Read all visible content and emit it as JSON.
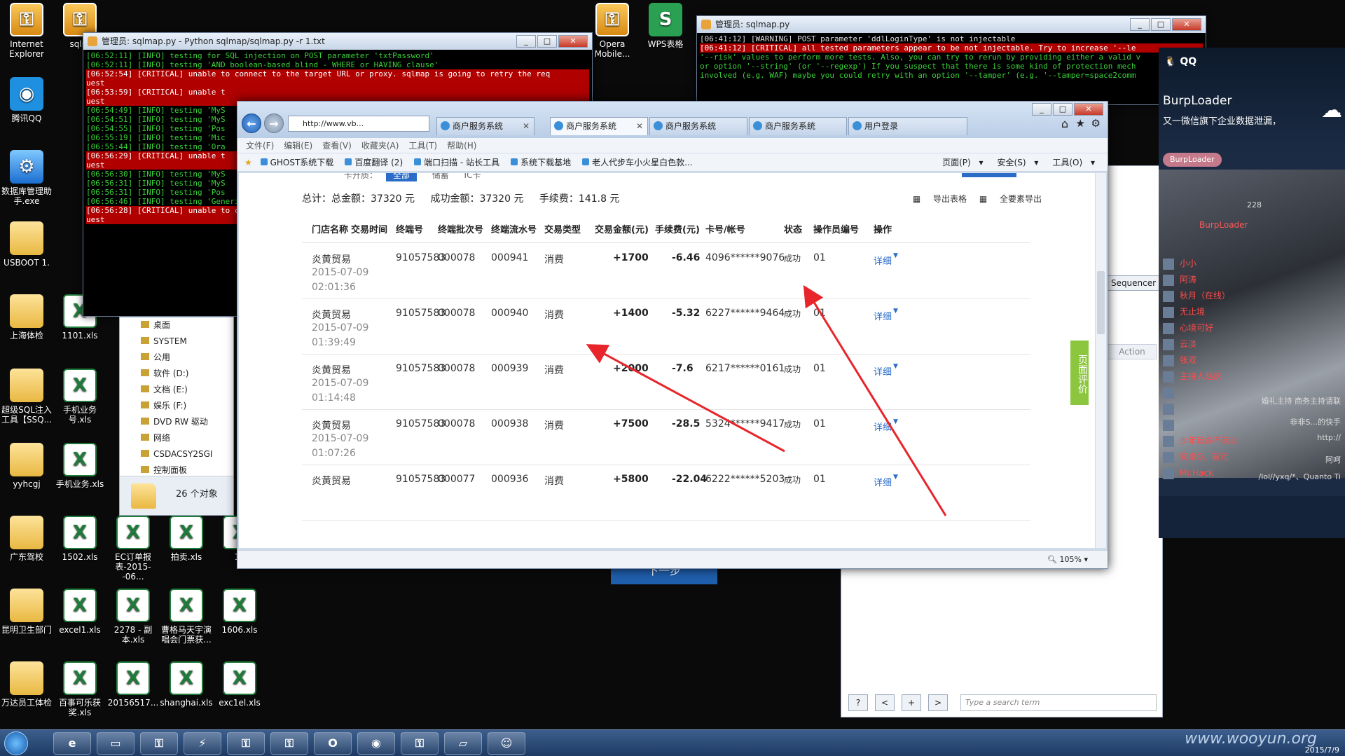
{
  "desktop": {
    "icons": [
      {
        "label": "Internet Explorer",
        "glyph": "key-icon"
      },
      {
        "label": "sqlm",
        "glyph": "key-icon"
      },
      {
        "label": "腾讯QQ",
        "glyph": "qq-icon"
      },
      {
        "label": "数据库管理助手.exe",
        "glyph": "app-icon"
      },
      {
        "label": "USBOOT 1.",
        "glyph": "folder-icon"
      },
      {
        "label": "上海体检",
        "glyph": "folder-icon"
      },
      {
        "label": "1101.xls",
        "glyph": "xls-icon"
      },
      {
        "label": "超级SQL注入工具【SSQ...",
        "glyph": "folder-icon"
      },
      {
        "label": "手机业务号.xls",
        "glyph": "xls-icon"
      },
      {
        "label": "yyhcgj",
        "glyph": "folder-icon"
      },
      {
        "label": "手机业务.xls",
        "glyph": "xls-icon"
      },
      {
        "label": "广东驾校",
        "glyph": "folder-icon"
      },
      {
        "label": "1502.xls",
        "glyph": "xls-icon"
      },
      {
        "label": "EC订单报表-2015--06...",
        "glyph": "xls-icon"
      },
      {
        "label": "拍卖.xls",
        "glyph": "xls-icon"
      },
      {
        "label": "13",
        "glyph": "xls-icon"
      },
      {
        "label": "昆明卫生部门",
        "glyph": "folder-icon"
      },
      {
        "label": "excel1.xls",
        "glyph": "xls-icon"
      },
      {
        "label": "2278 - 副本.xls",
        "glyph": "xls-icon"
      },
      {
        "label": "曹格马天宇演唱会门票获...",
        "glyph": "xls-icon"
      },
      {
        "label": "1606.xls",
        "glyph": "xls-icon"
      },
      {
        "label": "万达员工体检",
        "glyph": "folder-icon"
      },
      {
        "label": "百事可乐获奖.xls",
        "glyph": "xls-icon"
      },
      {
        "label": "20156517...",
        "glyph": "xls-icon"
      },
      {
        "label": "shanghai.xls",
        "glyph": "xls-icon"
      },
      {
        "label": "exc1el.xls",
        "glyph": "xls-icon"
      },
      {
        "label": "Opera Mobile...",
        "glyph": "key-icon"
      },
      {
        "label": "WPS表格",
        "glyph": "wps-icon"
      }
    ]
  },
  "console1": {
    "title": "管理员: sqlmap.py - Python  sqlmap/sqlmap.py -r 1.txt",
    "lines": [
      "[06:52:11] [INFO] testing for SQL injection on POST parameter 'txtPassword'",
      "[06:52:11] [INFO] testing 'AND boolean-based blind - WHERE or HAVING clause'",
      "[06:52:54] [CRITICAL] unable to connect to the target URL or proxy. sqlmap is going to retry the req",
      "uest",
      "[06:53:59] [CRITICAL] unable t",
      "uest",
      "[06:54:49] [INFO] testing 'MyS",
      "[06:54:51] [INFO] testing 'MyS",
      "[06:54:55] [INFO] testing 'Pos",
      "[06:55:19] [INFO] testing 'Mic",
      "[06:55:44] [INFO] testing 'Ora",
      "[06:56:29] [CRITICAL] unable t",
      "uest",
      "[06:56:30] [INFO] testing 'MyS",
      "[06:56:31] [INFO] testing 'MyS",
      "[06:56:31] [INFO] testing 'Pos",
      "[06:56:46] [INFO] testing 'Generic UN",
      "[06:56:28] [CRITICAL] unable to conne",
      "uest"
    ]
  },
  "console2": {
    "title": "管理员: sqlmap.py",
    "lines": [
      "[06:41:12] [WARNING] POST parameter 'ddlLoginType' is not injectable",
      "[06:41:12] [CRITICAL] all tested parameters appear to be not injectable. Try to increase '--le",
      "'--risk' values to perform more tests. Also, you can try to rerun by providing either a valid v",
      "or option '--string' (or '--regexp') If you suspect that there is some kind of protection mech",
      "involved (e.g. WAF) maybe you could retry with an option '--tamper' (e.g. '--tamper=space2comm"
    ]
  },
  "explorer": {
    "items": [
      "桌面",
      "SYSTEM",
      "公用",
      "软件 (D:)",
      "文档 (E:)",
      "娱乐 (F:)",
      "DVD RW 驱动",
      "网络",
      "CSDACSY2SGI",
      "控制面板"
    ],
    "status": "26 个对象"
  },
  "ie": {
    "address": "http://www.vb...",
    "tabs": [
      "商户服务系统",
      "商户服务系统",
      "商户服务系统",
      "商户服务系统",
      "用户登录"
    ],
    "menu": [
      "文件(F)",
      "编辑(E)",
      "查看(V)",
      "收藏夹(A)",
      "工具(T)",
      "帮助(H)"
    ],
    "favorites": [
      "GHOST系统下载",
      "百度翻译 (2)",
      "端口扫描 - 站长工具",
      "系统下载基地",
      "老人代步车小火星白色款..."
    ],
    "commands": [
      "页面(P)",
      "安全(S)",
      "工具(O)"
    ],
    "zoom": "105%",
    "summary": {
      "total": "总计：总金额：37320 元",
      "success": "成功金额：37320 元",
      "fee": "手续费：141.8 元"
    },
    "exports": [
      "导出表格",
      "全要素导出"
    ],
    "filter_tabs": [
      "全部",
      "储蓄",
      "IC卡"
    ],
    "filter_label": "卡开质：",
    "columns": [
      "门店名称",
      "交易时间",
      "终端号",
      "终端批次号",
      "终端流水号",
      "交易类型",
      "交易金额(元)",
      "手续费(元)",
      "卡号/帐号",
      "状态",
      "操作员编号",
      "操作"
    ],
    "rows": [
      {
        "store": "炎黄贸易",
        "date": "2015-07-09",
        "time": "02:01:36",
        "terminal": "91057583",
        "batch": "000078",
        "serial": "000941",
        "type": "消费",
        "amount": "+1700",
        "fee": "-6.46",
        "card": "4096******9076",
        "status": "成功",
        "op": "01",
        "action": "详细"
      },
      {
        "store": "炎黄贸易",
        "date": "2015-07-09",
        "time": "01:39:49",
        "terminal": "91057583",
        "batch": "000078",
        "serial": "000940",
        "type": "消费",
        "amount": "+1400",
        "fee": "-5.32",
        "card": "6227******9464",
        "status": "成功",
        "op": "01",
        "action": "详细"
      },
      {
        "store": "炎黄贸易",
        "date": "2015-07-09",
        "time": "01:14:48",
        "terminal": "91057583",
        "batch": "000078",
        "serial": "000939",
        "type": "消费",
        "amount": "+2000",
        "fee": "-7.6",
        "card": "6217******0161",
        "status": "成功",
        "op": "01",
        "action": "详细"
      },
      {
        "store": "炎黄贸易",
        "date": "2015-07-09",
        "time": "01:07:26",
        "terminal": "91057583",
        "batch": "000078",
        "serial": "000938",
        "type": "消费",
        "amount": "+7500",
        "fee": "-28.5",
        "card": "5324******9417",
        "status": "成功",
        "op": "01",
        "action": "详细"
      },
      {
        "store": "炎黄贸易",
        "date": "",
        "time": "",
        "terminal": "91057583",
        "batch": "000077",
        "serial": "000936",
        "type": "消费",
        "amount": "+5800",
        "fee": "-22.04",
        "card": "6222******5203",
        "status": "成功",
        "op": "01",
        "action": "详细"
      }
    ],
    "next_button": "下一步",
    "feedback": "页面评价"
  },
  "bgapp": {
    "sequencer": "Sequencer",
    "action": "Action",
    "search_placeholder": "Type a search term",
    "nav_buttons": [
      "?",
      "<",
      "+",
      ">"
    ]
  },
  "qq": {
    "title": "QQ",
    "user": "BurpLoader",
    "signature": "又一微信旗下企业数据泄漏，",
    "tag": "BurpLoader",
    "count": "228",
    "group_first": "BurpLoader",
    "members": [
      "小小",
      "阿涛",
      "秋月（在线）",
      "无止境",
      "心境可好",
      "云淡",
      "张双",
      "主持人赵庆",
      "",
      "",
      "",
      "少年玩命不玩心",
      "安卓Q。盲元",
      "Mr.Hack"
    ],
    "snippets": [
      "婚礼主持 商务主持请联",
      "非非S...的快手",
      "http://",
      "阿呵",
      "/lol//yxq/*、Quanto Ti"
    ]
  },
  "taskbar": {
    "clock_time": "",
    "clock_date": "2015/7/9",
    "watermark": "www.wooyun.org"
  }
}
